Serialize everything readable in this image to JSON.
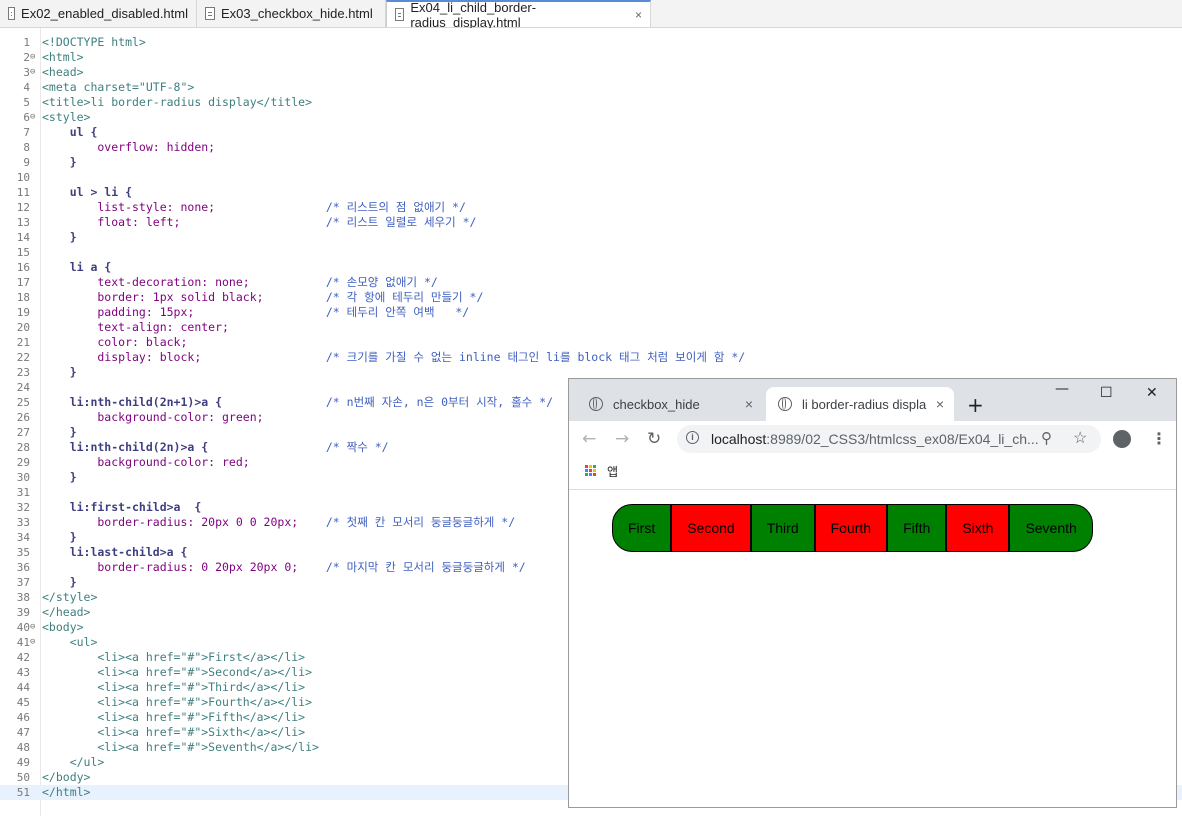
{
  "editor_tabs": [
    {
      "label": "Ex02_enabled_disabled.html",
      "active": false
    },
    {
      "label": "Ex03_checkbox_hide.html",
      "active": false
    },
    {
      "label": "Ex04_li_child_border-radius_display.html",
      "active": true
    }
  ],
  "code_lines": [
    "<!DOCTYPE html>",
    "<html>",
    "<head>",
    "<meta charset=\"UTF-8\">",
    "<title>li border-radius display</title>",
    "<style>",
    "    ul {",
    "        overflow: hidden;",
    "    }",
    "",
    "    ul > li {",
    "        list-style: none;                /* 리스트의 점 없애기 */",
    "        float: left;                     /* 리스트 일렬로 세우기 */",
    "    }",
    "",
    "    li a {",
    "        text-decoration: none;           /* 손모양 없애기 */",
    "        border: 1px solid black;         /* 각 항에 테두리 만들기 */",
    "        padding: 15px;                   /* 테두리 안쪽 여백   */",
    "        text-align: center;",
    "        color: black;",
    "        display: block;                  /* 크기를 가질 수 없는 inline 태그인 li를 block 태그 처럼 보이게 함 */",
    "    }",
    "",
    "    li:nth-child(2n+1)>a {               /* n번째 자손, n은 0부터 시작, 홀수 */",
    "        background-color: green;",
    "    }",
    "    li:nth-child(2n)>a {                 /* 짝수 */",
    "        background-color: red;",
    "    }",
    "",
    "    li:first-child>a  {",
    "        border-radius: 20px 0 0 20px;    /* 첫째 칸 모서리 둥글둥글하게 */",
    "    }",
    "    li:last-child>a {",
    "        border-radius: 0 20px 20px 0;    /* 마지막 칸 모서리 둥글둥글하게 */",
    "    }",
    "</style>",
    "</head>",
    "<body>",
    "    <ul>",
    "        <li><a href=\"#\">First</a></li>",
    "        <li><a href=\"#\">Second</a></li>",
    "        <li><a href=\"#\">Third</a></li>",
    "        <li><a href=\"#\">Fourth</a></li>",
    "        <li><a href=\"#\">Fifth</a></li>",
    "        <li><a href=\"#\">Sixth</a></li>",
    "        <li><a href=\"#\">Seventh</a></li>",
    "    </ul>",
    "</body>",
    "</html>"
  ],
  "fold_lines": [
    2,
    3,
    6,
    40,
    41
  ],
  "current_line": 51,
  "browser": {
    "tabs": [
      {
        "label": "checkbox_hide",
        "close": "×",
        "active": false
      },
      {
        "label": "li border-radius displa",
        "close": "×",
        "active": true
      }
    ],
    "new_tab": "+",
    "window_controls": {
      "minimize": "—",
      "maximize": "☐",
      "close": "✕"
    },
    "nav": {
      "back": "←",
      "forward": "→",
      "reload": "↻"
    },
    "url_host": "localhost",
    "url_path": ":8989/02_CSS3/htmlcss_ex08/Ex04_li_ch...",
    "bookmark_apps_label": "앱",
    "apps_colors": [
      "#ea4335",
      "#fbbc05",
      "#34a853",
      "#4285f4",
      "#ea4335",
      "#fbbc05",
      "#34a853",
      "#4285f4",
      "#ea4335"
    ],
    "list_items": [
      {
        "label": "First",
        "color": "#008000"
      },
      {
        "label": "Second",
        "color": "#ff0000"
      },
      {
        "label": "Third",
        "color": "#008000"
      },
      {
        "label": "Fourth",
        "color": "#ff0000"
      },
      {
        "label": "Fifth",
        "color": "#008000"
      },
      {
        "label": "Sixth",
        "color": "#ff0000"
      },
      {
        "label": "Seventh",
        "color": "#008000"
      }
    ]
  }
}
